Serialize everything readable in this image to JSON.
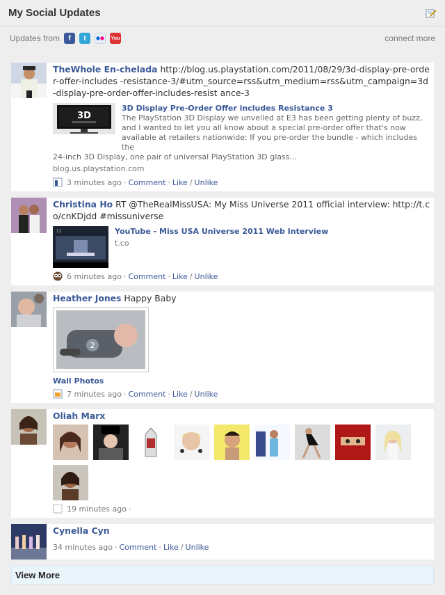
{
  "header": {
    "title": "My Social Updates"
  },
  "subbar": {
    "label": "Updates from",
    "services": [
      {
        "name": "facebook",
        "glyph": "f",
        "color": "#3b5998"
      },
      {
        "name": "twitter",
        "glyph": "t",
        "color": "#33a5d8"
      },
      {
        "name": "flickr",
        "glyph": "",
        "color": "#e8eef8"
      },
      {
        "name": "youtube",
        "glyph": "You",
        "color": "#dd3333"
      }
    ],
    "connect_more": "connect more"
  },
  "feed": [
    {
      "author": "TheWhole En-chelada",
      "text": "http://blog.us.playstation.com/2011/08/29/3d-display-pre-order-offer-includes -resistance-3/#utm_source=rss&utm_medium=rss&utm_campaign=3d-display-pre-order-offer-includes-resist ance-3",
      "attachment": {
        "title": "3D Display Pre-Order Offer includes Resistance 3",
        "desc_top": "The PlayStation 3D Display we unveiled at E3 has been getting plenty of buzz, and I wanted to let you all know about a special pre-order offer that's now available at retailers nationwide: If you pre-order the bundle - which includes the",
        "desc_bottom": "24-inch 3D Display, one pair of universal PlayStation 3D glass...",
        "source": "blog.us.playstation.com"
      },
      "meta": {
        "time": "3 minutes ago",
        "comment": "Comment",
        "like": "Like",
        "unlike": "Unlike"
      }
    },
    {
      "author": "Christina Ho",
      "text": "RT @TheRealMissUSA: My Miss Universe 2011 official interview: http://t.co/cnKDjdd #missuniverse",
      "attachment": {
        "title": "YouTube - Miss USA Universe 2011 Web Interview",
        "source": "t.co"
      },
      "meta": {
        "time": "6 minutes ago",
        "comment": "Comment",
        "like": "Like",
        "unlike": "Unlike"
      }
    },
    {
      "author": "Heather Jones",
      "text": "Happy Baby",
      "album": "Wall Photos",
      "meta": {
        "time": "7 minutes ago",
        "comment": "Comment",
        "like": "Like",
        "unlike": "Unlike"
      }
    },
    {
      "author": "Oliah Marx",
      "meta": {
        "time": "19 minutes ago"
      }
    },
    {
      "author": "Cynella Cyn",
      "meta": {
        "time": "34 minutes ago",
        "comment": "Comment",
        "like": "Like",
        "unlike": "Unlike"
      }
    }
  ],
  "view_more": "View More",
  "colors": {
    "link": "#3b5998",
    "panel_bg": "#eeeeee",
    "view_more_bg": "#eaf4fb"
  }
}
